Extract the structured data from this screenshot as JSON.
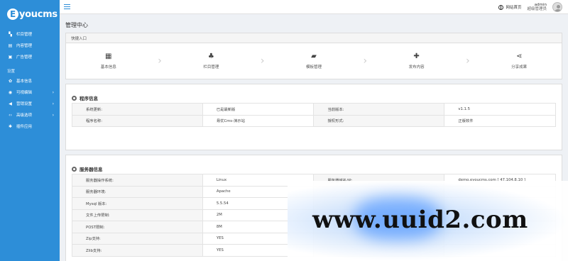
{
  "brand": {
    "logo_text": "youcms",
    "logo_letter": "E"
  },
  "sidebar": {
    "items": [
      {
        "label": "栏目管理",
        "icon": "sitemap-icon",
        "glyph": "▚"
      },
      {
        "label": "内容管理",
        "icon": "list-icon",
        "glyph": "▤"
      },
      {
        "label": "广告管理",
        "icon": "image-icon",
        "glyph": "▣"
      }
    ],
    "section_label": "设置",
    "settings_items": [
      {
        "label": "基本信息",
        "icon": "gear-icon",
        "glyph": "✿",
        "arrow": ""
      },
      {
        "label": "可视编辑",
        "icon": "eye-icon",
        "glyph": "◉",
        "arrow": "›"
      },
      {
        "label": "营销设置",
        "icon": "megaphone-icon",
        "glyph": "◀",
        "arrow": "›"
      },
      {
        "label": "高级选项",
        "icon": "code-icon",
        "glyph": "‹›",
        "arrow": "›"
      },
      {
        "label": "插件应用",
        "icon": "puzzle-icon",
        "glyph": "✱",
        "arrow": ""
      }
    ]
  },
  "topbar": {
    "site_home": "网站首页",
    "user_name": "admin",
    "user_role": "超级管理员"
  },
  "page_title": "管理中心",
  "quick": {
    "header": "快捷入口",
    "items": [
      {
        "label": "基本信息",
        "icon": "id-card-icon",
        "glyph": "▦"
      },
      {
        "label": "栏目管理",
        "icon": "sitemap-icon",
        "glyph": "♣"
      },
      {
        "label": "模板管理",
        "icon": "folder-open-icon",
        "glyph": "▰"
      },
      {
        "label": "发布内容",
        "icon": "plus-icon",
        "glyph": "✚"
      },
      {
        "label": "分享成果",
        "icon": "share-icon",
        "glyph": "⋖"
      }
    ]
  },
  "program": {
    "title": "程序信息",
    "rows": [
      [
        "系统更新:",
        "已是最新版",
        "当前版本:",
        "v1.1.5"
      ],
      [
        "程序名称:",
        "易优Cms-演示站",
        "授权形式:",
        "正版软件"
      ]
    ]
  },
  "server": {
    "title": "服务器信息",
    "rows": [
      [
        "服务器操作系统:",
        "Linux",
        "服务器域名/IP:",
        "demo.eyoucms.com [ 47.104.8.10 ]"
      ],
      [
        "服务器环境:",
        "Apache",
        "",
        ""
      ],
      [
        "Mysql 版本:",
        "5.5.54",
        "",
        ""
      ],
      [
        "文件上传限制:",
        "2M",
        "",
        ""
      ],
      [
        "POST限制:",
        "8M",
        "",
        ""
      ],
      [
        "Zip支持:",
        "YES",
        "",
        ""
      ],
      [
        "Zlib支持:",
        "YES",
        "",
        ""
      ]
    ]
  },
  "watermark": "www.uuid2.com"
}
